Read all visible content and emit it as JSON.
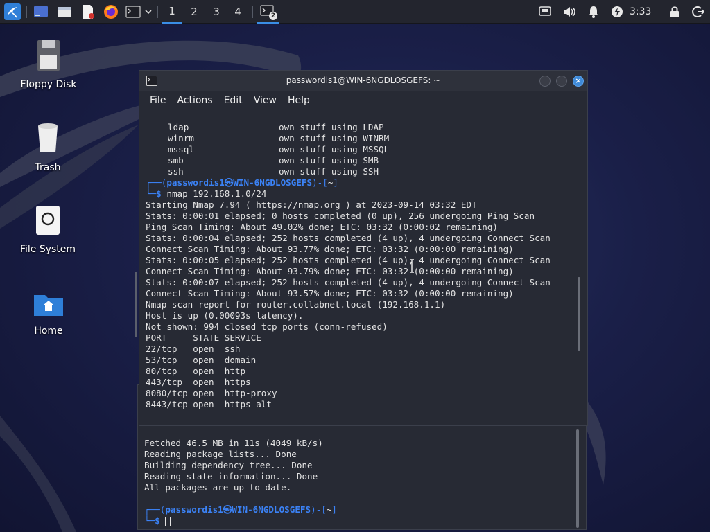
{
  "panel": {
    "workspaces": [
      "1",
      "2",
      "3",
      "4"
    ],
    "terminal_badge": "2",
    "clock": "3:33"
  },
  "desktop": {
    "icons": [
      {
        "label": "Floppy Disk"
      },
      {
        "label": "Trash"
      },
      {
        "label": "File System"
      },
      {
        "label": "Home"
      }
    ]
  },
  "terminal_front": {
    "title": "passwordis1@WIN-6NGDLOSGEFS: ~",
    "menu": [
      "File",
      "Actions",
      "Edit",
      "View",
      "Help"
    ],
    "proto_lines": [
      {
        "proto": "ldap",
        "desc": "own stuff using LDAP"
      },
      {
        "proto": "winrm",
        "desc": "own stuff using WINRM"
      },
      {
        "proto": "mssql",
        "desc": "own stuff using MSSQL"
      },
      {
        "proto": "smb",
        "desc": "own stuff using SMB"
      },
      {
        "proto": "ssh",
        "desc": "own stuff using SSH"
      }
    ],
    "prompt_user": "passwordis1㉿WIN-6NGDLOSGEFS",
    "prompt_dir": "~",
    "command": "nmap 192.168.1.0/24",
    "output": [
      "Starting Nmap 7.94 ( https://nmap.org ) at 2023-09-14 03:32 EDT",
      "Stats: 0:00:01 elapsed; 0 hosts completed (0 up), 256 undergoing Ping Scan",
      "Ping Scan Timing: About 49.02% done; ETC: 03:32 (0:00:02 remaining)",
      "Stats: 0:00:04 elapsed; 252 hosts completed (4 up), 4 undergoing Connect Scan",
      "Connect Scan Timing: About 93.77% done; ETC: 03:32 (0:00:00 remaining)",
      "Stats: 0:00:05 elapsed; 252 hosts completed (4 up), 4 undergoing Connect Scan",
      "Connect Scan Timing: About 93.79% done; ETC: 03:32 (0:00:00 remaining)",
      "Stats: 0:00:07 elapsed; 252 hosts completed (4 up), 4 undergoing Connect Scan",
      "Connect Scan Timing: About 93.57% done; ETC: 03:32 (0:00:00 remaining)",
      "Nmap scan report for router.collabnet.local (192.168.1.1)",
      "Host is up (0.00093s latency).",
      "Not shown: 994 closed tcp ports (conn-refused)",
      "PORT     STATE SERVICE",
      "22/tcp   open  ssh",
      "53/tcp   open  domain",
      "80/tcp   open  http",
      "443/tcp  open  https",
      "8080/tcp open  http-proxy",
      "8443/tcp open  https-alt"
    ]
  },
  "terminal_back": {
    "output": [
      "Fetched 46.5 MB in 11s (4049 kB/s)",
      "Reading package lists... Done",
      "Building dependency tree... Done",
      "Reading state information... Done",
      "All packages are up to date."
    ],
    "prompt_user": "passwordis1㉿WIN-6NGDLOSGEFS",
    "prompt_dir": "~"
  }
}
